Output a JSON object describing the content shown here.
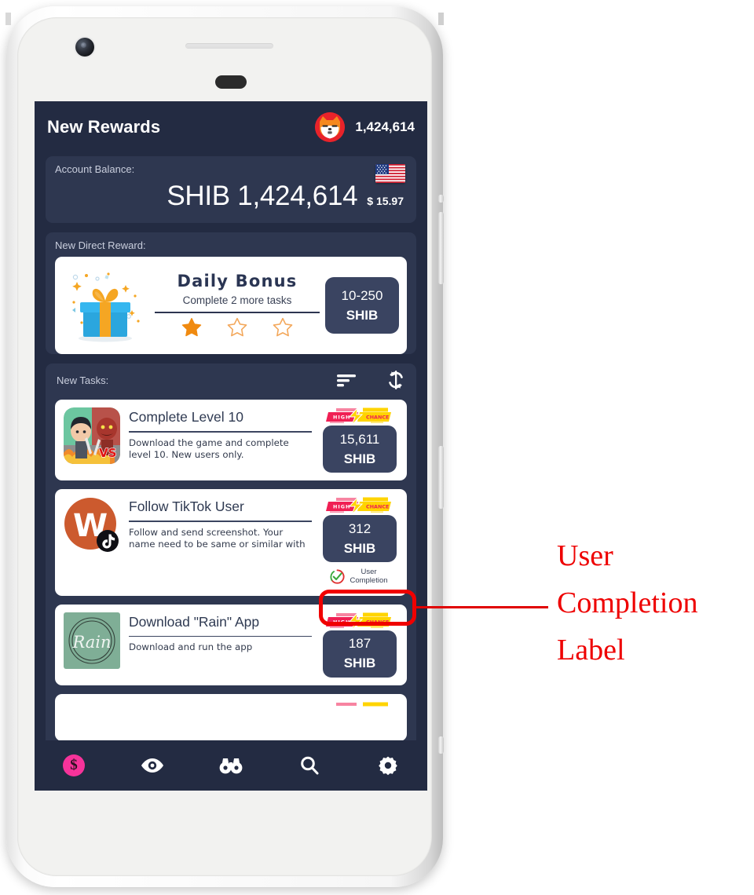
{
  "header": {
    "title": "New Rewards",
    "logo_icon": "shiba-inu-logo",
    "balance_amount": "1,424,614"
  },
  "balance_card": {
    "label": "Account Balance:",
    "flag_icon": "usa-flag-icon",
    "currency": "SHIB",
    "amount": "1,424,614",
    "amount_full": "SHIB 1,424,614",
    "usd_value": "$ 15.97"
  },
  "direct_reward": {
    "label": "New Direct Reward:",
    "illustration_icon": "gift-box-icon",
    "title": "Daily Bonus",
    "subtitle": "Complete 2 more tasks",
    "stars_filled": 1,
    "stars_total": 3,
    "reward_amount": "10-250",
    "reward_unit": "SHIB"
  },
  "tasks_section": {
    "label": "New Tasks:",
    "sort_icon": "sort-icon",
    "refresh_icon": "refresh-icon",
    "badge_high": "H I G H",
    "badge_chance": "CHANCE",
    "tasks": [
      {
        "thumb_icon": "game-battle-icon",
        "title": "Complete Level 10",
        "description": "Download the game and complete level 10. New users only.",
        "badge_icon": "high-chance-badge",
        "reward_amount": "15,611",
        "reward_unit": "SHIB",
        "completion": null
      },
      {
        "thumb_icon": "tiktok-avatar-icon",
        "avatar_letter": "W",
        "title": "Follow TikTok User",
        "description": "Follow and send screenshot. Your name need to be same or similar with your user login in",
        "badge_icon": "high-chance-badge",
        "reward_amount": "312",
        "reward_unit": "SHIB",
        "completion": {
          "icon": "user-completion-check-icon",
          "line1": "User",
          "line2": "Completion"
        }
      },
      {
        "thumb_icon": "rain-app-icon",
        "thumb_text": "Rain",
        "title": "Download \"Rain\" App",
        "description": "Download and run the app",
        "badge_icon": "high-chance-badge",
        "reward_amount": "187",
        "reward_unit": "SHIB",
        "completion": null
      }
    ]
  },
  "bottom_nav": {
    "items": [
      {
        "icon": "dollar-coin-icon",
        "active": true
      },
      {
        "icon": "eye-icon",
        "active": false
      },
      {
        "icon": "binoculars-icon",
        "active": false
      },
      {
        "icon": "search-icon",
        "active": false
      },
      {
        "icon": "gear-icon",
        "active": false
      }
    ]
  },
  "annotation": {
    "line1": "User",
    "line2": "Completion",
    "line3": "Label",
    "color": "#ee0000"
  },
  "colors": {
    "app_background": "#232b42",
    "panel": "#2e3750",
    "card": "#ffffff",
    "reward_pill": "#3a4461",
    "accent_pink": "#f6339a",
    "badge_red": "#f01f54",
    "badge_yellow": "#ffd400",
    "star_orange": "#f08a10",
    "annotation_red": "#ee0000"
  }
}
